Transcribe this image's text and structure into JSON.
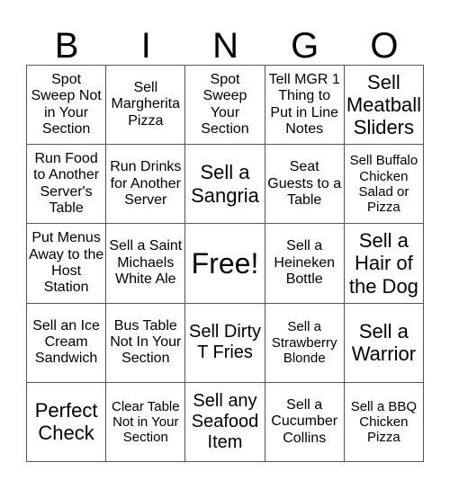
{
  "header": {
    "letters": [
      "B",
      "I",
      "N",
      "G",
      "O"
    ]
  },
  "cells": [
    "Spot Sweep Not in Your Section",
    "Sell Margherita Pizza",
    "Spot Sweep Your Section",
    "Tell MGR 1 Thing to Put in Line Notes",
    "Sell Meatball Sliders",
    "Run Food to Another Server's Table",
    "Run Drinks for Another Server",
    "Sell a Sangria",
    "Seat Guests to a Table",
    "Sell Buffalo Chicken Salad or Pizza",
    "Put Menus Away to the Host Station",
    "Sell a Saint Michaels White Ale",
    "Free!",
    "Sell a Heineken Bottle",
    "Sell a Hair of the Dog",
    "Sell an Ice Cream Sandwich",
    "Bus Table Not In Your Section",
    "Sell Dirty T Fries",
    "Sell a Strawberry Blonde",
    "Sell a Warrior",
    "Perfect Check",
    "Clear Table Not in Your Section",
    "Sell any Seafood Item",
    "Sell a Cucumber Collins",
    "Sell a BBQ Chicken Pizza"
  ]
}
